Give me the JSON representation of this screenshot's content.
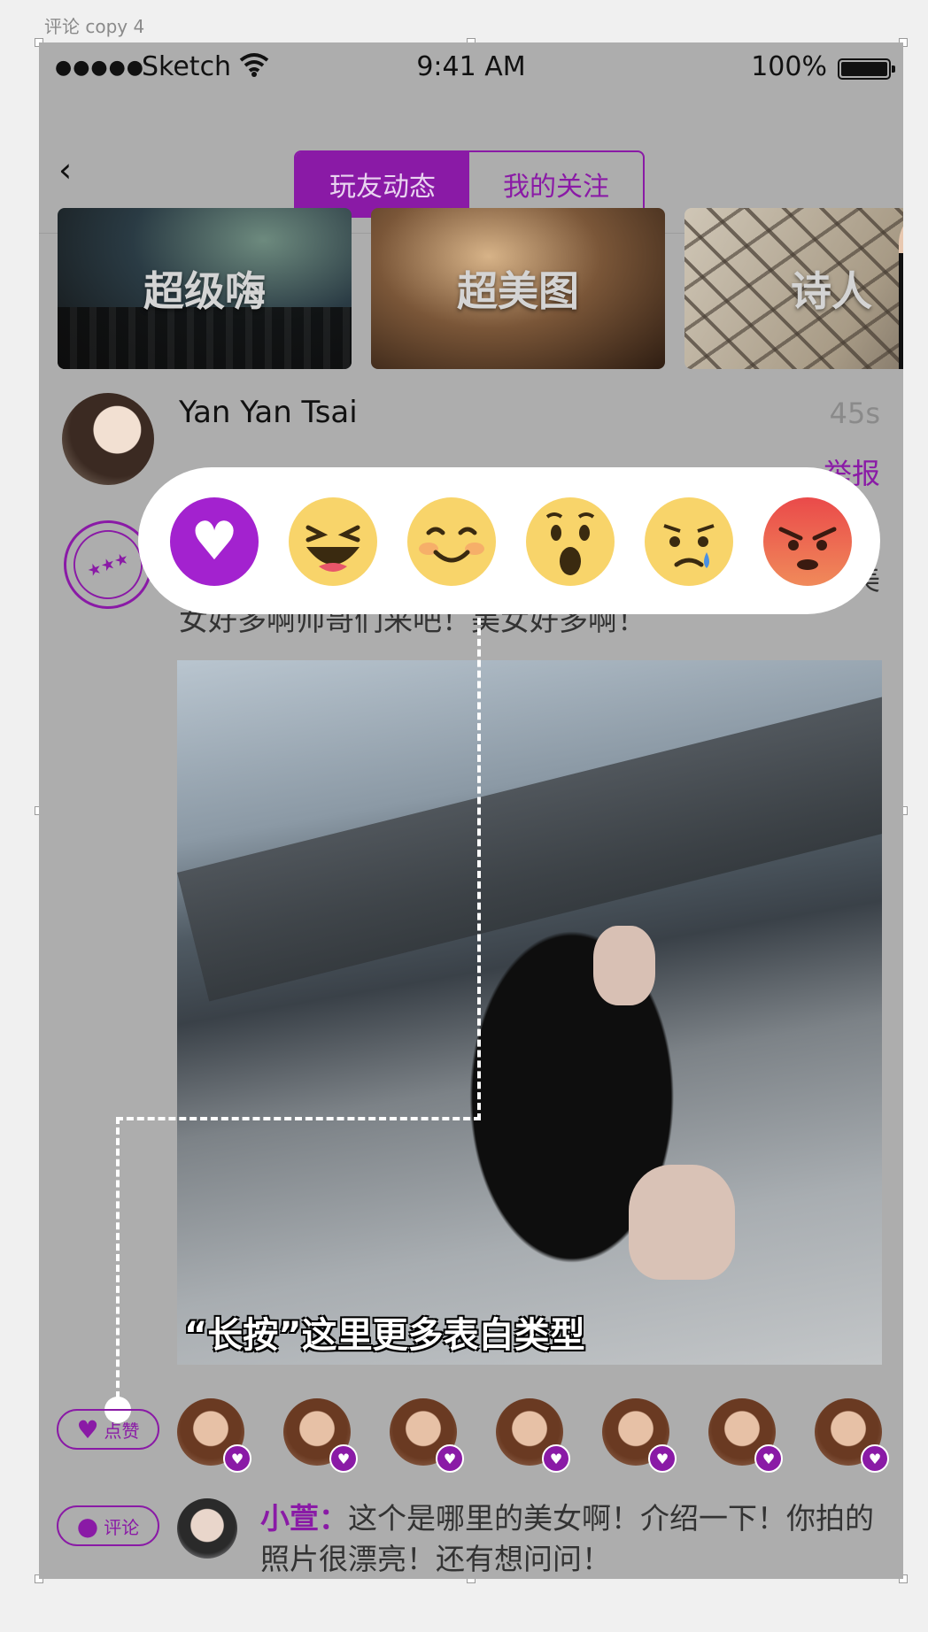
{
  "artboard_label": "评论 copy 4",
  "status_bar": {
    "dots": "●●●●●",
    "carrier": "Sketch",
    "wifi_icon": "wifi-icon",
    "time": "9:41 AM",
    "battery": "100%"
  },
  "nav": {
    "back": "‹",
    "tabs": [
      {
        "label": "玩友动态",
        "active": true
      },
      {
        "label": "我的关注",
        "active": false
      }
    ]
  },
  "topics": [
    {
      "label": "超级嗨"
    },
    {
      "label": "超美图"
    },
    {
      "label": "诗人"
    }
  ],
  "post": {
    "author": "Yan Yan Tsai",
    "time": "45s",
    "report": "举报",
    "text": "女好多啊！帅哥们来吧！美女好多啊！帅哥们来吧！美女好多啊帅哥们来吧！美女好多啊！",
    "photo_caption": "“长按”这里更多表白类型"
  },
  "reactions": [
    {
      "name": "love",
      "glyph": "♥"
    },
    {
      "name": "haha"
    },
    {
      "name": "smile"
    },
    {
      "name": "wow"
    },
    {
      "name": "sad"
    },
    {
      "name": "angry"
    }
  ],
  "actions": {
    "like_label": "点赞",
    "comment_label": "评论"
  },
  "likers_count": 7,
  "comment": {
    "user": "小萱：",
    "text": "这个是哪里的美女啊！介绍一下！你拍的照片很漂亮！还有想问问！"
  },
  "colors": {
    "accent": "#8a1aa6",
    "screen_bg": "#adadad"
  }
}
